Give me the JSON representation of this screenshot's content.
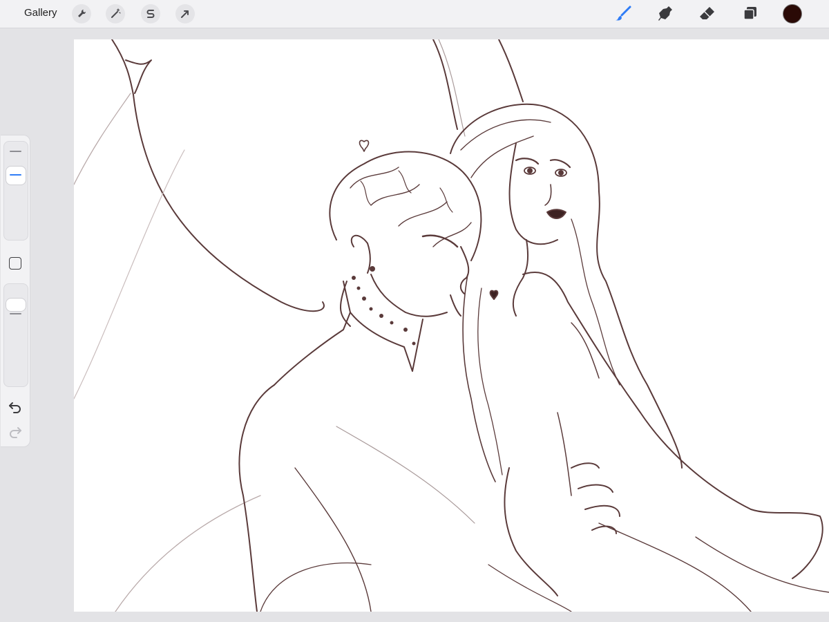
{
  "toolbar": {
    "gallery_label": "Gallery",
    "left_tools": [
      {
        "name": "actions",
        "icon": "wrench-icon"
      },
      {
        "name": "adjustments",
        "icon": "magic-wand-icon"
      },
      {
        "name": "selection",
        "icon": "selection-s-icon"
      },
      {
        "name": "transform",
        "icon": "arrow-cursor-icon"
      }
    ],
    "right_tools": [
      {
        "name": "brush",
        "icon": "brush-icon",
        "active": true
      },
      {
        "name": "smudge",
        "icon": "smudge-finger-icon",
        "active": false
      },
      {
        "name": "eraser",
        "icon": "eraser-icon",
        "active": false
      },
      {
        "name": "layers",
        "icon": "layers-icon",
        "active": false
      }
    ],
    "current_color": "#2a0a06",
    "accent_color": "#2f7cf6"
  },
  "sidebar": {
    "brush_size_level": 0.7,
    "opacity_level": 0.85,
    "modify_button_icon": "square-icon",
    "undo_icon": "undo-arrow-icon",
    "redo_icon": "redo-arrow-icon"
  },
  "canvas": {
    "line_color": "#5a3a3a",
    "content": "line-art-illustration"
  }
}
